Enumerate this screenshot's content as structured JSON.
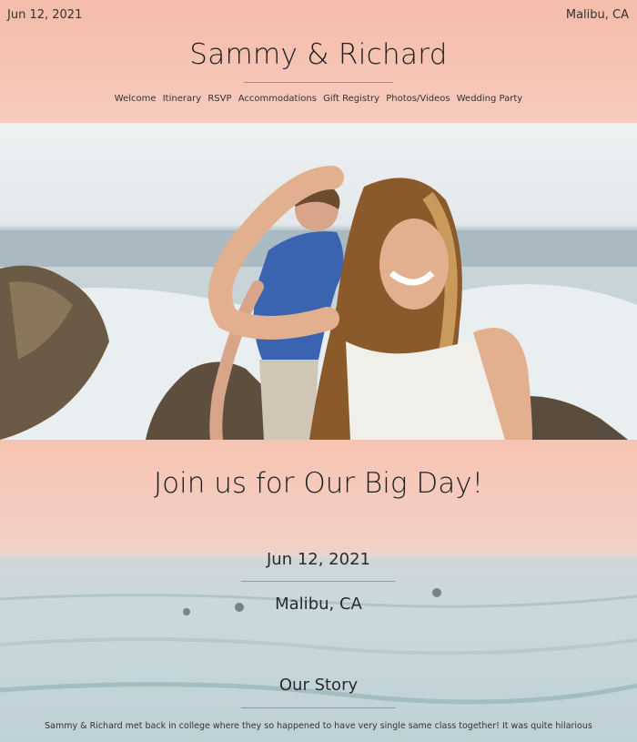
{
  "header": {
    "date": "Jun 12, 2021",
    "location": "Malibu, CA",
    "title": "Sammy & Richard",
    "nav": [
      "Welcome",
      "Itinerary",
      "RSVP",
      "Accommodations",
      "Gift Registry",
      "Photos/Videos",
      "Wedding Party"
    ]
  },
  "hero": {
    "image": "couple-on-beach-photo"
  },
  "event": {
    "heading": "Join us for Our Big Day!",
    "date": "Jun 12, 2021",
    "location": "Malibu, CA"
  },
  "story": {
    "heading": "Our Story",
    "text": "Sammy & Richard met back in college where they so happened to have very single same class together! It was quite hilarious"
  },
  "colors": {
    "header_bg": "#f4bcaa",
    "text": "#222222"
  }
}
